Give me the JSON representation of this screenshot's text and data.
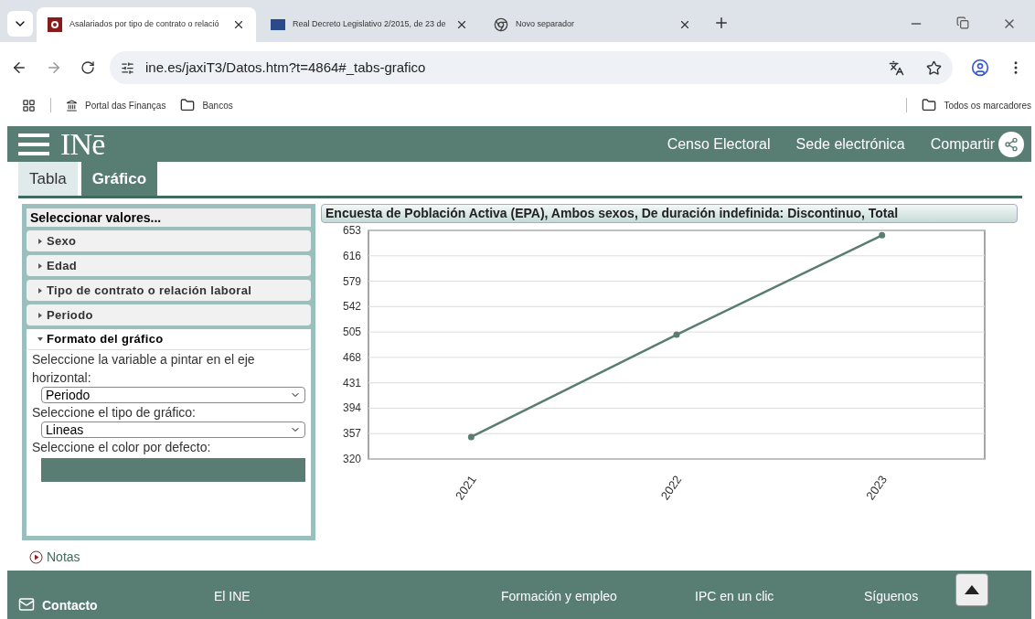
{
  "browser": {
    "tabs": [
      {
        "title": "Asalariados por tipo de contrato o relació",
        "selected": true,
        "kind": "ine"
      },
      {
        "title": "Real Decreto Legislativo 2/2015, de 23 de",
        "selected": false,
        "kind": "boe"
      },
      {
        "title": "Novo separador",
        "selected": false,
        "kind": "chrome"
      }
    ],
    "address": "ine.es/jaxiT3/Datos.htm?t=4864#_tabs-grafico",
    "bookmarks": [
      {
        "label": "Portal das Finanças",
        "kind": "site"
      },
      {
        "label": "Bancos",
        "kind": "folder"
      }
    ],
    "all_bookmarks": "Todos os marcadores"
  },
  "header": {
    "logo": "INē",
    "nav": [
      "Censo Electoral",
      "Sede electrónica"
    ],
    "share": "Compartir"
  },
  "view_tabs": [
    {
      "label": "Tabla",
      "selected": false
    },
    {
      "label": "Gráfico",
      "selected": true
    }
  ],
  "panel": {
    "title": "Seleccionar valores...",
    "sections": [
      {
        "label": "Sexo",
        "expanded": false
      },
      {
        "label": "Edad",
        "expanded": false
      },
      {
        "label": "Tipo de contrato o relación laboral",
        "expanded": false
      },
      {
        "label": "Periodo",
        "expanded": false
      },
      {
        "label": "Formato del gráfico",
        "expanded": true,
        "fields": [
          {
            "kind": "select",
            "label": "Seleccione la variable a pintar en el eje horizontal:",
            "value": "Periodo"
          },
          {
            "kind": "select",
            "label": "Seleccione el tipo de gráfico:",
            "value": "Lineas"
          },
          {
            "kind": "color",
            "label": "Seleccione el color por defecto:",
            "color": "#5a7d73"
          }
        ]
      }
    ]
  },
  "notes": "Notas",
  "chart": {
    "title": "Encuesta de Población Activa (EPA), Ambos sexos, De duración indefinida: Discontinuo, Total",
    "chart_data": {
      "type": "line",
      "categories": [
        "2021",
        "2022",
        "2023"
      ],
      "series": [
        {
          "color": "#5a7d73",
          "marker": "circle",
          "values": [
            352,
            501,
            646
          ]
        }
      ],
      "grid": true,
      "ylim": [
        320,
        653
      ],
      "yticks": [
        320,
        357,
        394,
        431,
        468,
        505,
        542,
        579,
        616,
        653
      ]
    }
  },
  "footer": {
    "contact": "Contacto",
    "links": [
      "El INE",
      "Formación y empleo",
      "IPC en un clic",
      "Síguenos"
    ]
  }
}
